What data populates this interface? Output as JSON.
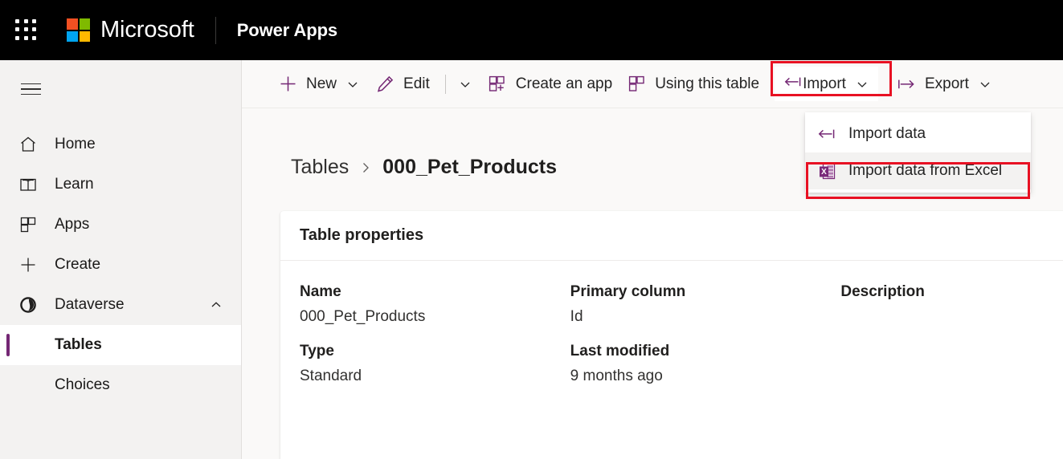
{
  "header": {
    "waffle_icon": "app-launcher-icon",
    "brand": "Microsoft",
    "app_name": "Power Apps",
    "logo_colors": [
      "#F25022",
      "#7FBA00",
      "#00A4EF",
      "#FFB900"
    ]
  },
  "sidebar": {
    "hamburger_icon": "hamburger-menu-icon",
    "items": [
      {
        "label": "Home",
        "icon": "home-icon",
        "active": false
      },
      {
        "label": "Learn",
        "icon": "book-icon",
        "active": false
      },
      {
        "label": "Apps",
        "icon": "apps-grid-icon",
        "active": false
      },
      {
        "label": "Create",
        "icon": "plus-icon",
        "active": false
      },
      {
        "label": "Dataverse",
        "icon": "dataverse-icon",
        "active": false,
        "expanded": true,
        "chevron": "chevron-up-icon"
      },
      {
        "label": "Tables",
        "icon": "",
        "active": true,
        "sub": true
      },
      {
        "label": "Choices",
        "icon": "",
        "active": false,
        "sub": true
      }
    ]
  },
  "commandbar": {
    "items": [
      {
        "label": "New",
        "icon": "plus-icon",
        "caret": true,
        "split": false
      },
      {
        "label": "Edit",
        "icon": "pencil-icon",
        "caret": true,
        "split": true
      },
      {
        "label": "Create an app",
        "icon": "create-app-icon",
        "caret": false,
        "split": false
      },
      {
        "label": "Using this table",
        "icon": "using-table-icon",
        "caret": false,
        "split": false
      }
    ],
    "import": {
      "label": "Import",
      "icon": "import-arrow-icon",
      "caret": true,
      "highlighted": true
    },
    "export": {
      "label": "Export",
      "icon": "export-arrow-icon",
      "caret": true,
      "highlighted": false
    }
  },
  "import_menu": {
    "visible": true,
    "items": [
      {
        "label": "Import data",
        "icon": "import-arrow-icon",
        "highlighted": false
      },
      {
        "label": "Import data from Excel",
        "icon": "excel-icon",
        "highlighted": true
      }
    ]
  },
  "main": {
    "breadcrumb": {
      "root": "Tables",
      "separator": "chevron-right-icon",
      "current": "000_Pet_Products"
    },
    "card": {
      "title": "Table properties",
      "columns": [
        {
          "key1": "Name",
          "val1": "000_Pet_Products",
          "key2": "Type",
          "val2": "Standard"
        },
        {
          "key1": "Primary column",
          "val1": "Id",
          "key2": "Last modified",
          "val2": "9 months ago"
        },
        {
          "key1": "Description",
          "val1": "",
          "key2": "",
          "val2": ""
        }
      ]
    }
  },
  "highlight": {
    "color": "#e81123"
  },
  "accent": {
    "purple": "#742774",
    "brand_purple": "#8A2BE2"
  }
}
